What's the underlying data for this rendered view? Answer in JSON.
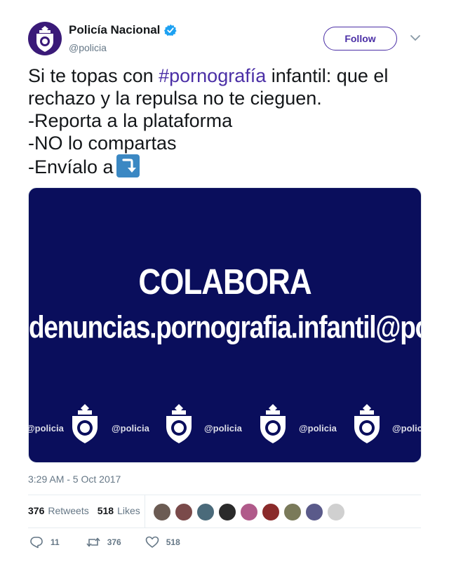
{
  "account": {
    "name": "Policía Nacional",
    "handle": "@policia",
    "verified": true,
    "follow_label": "Follow",
    "colors": {
      "accent": "#4b2fa6",
      "verified": "#1da1f2"
    }
  },
  "tweet": {
    "line1_prefix": "Si te topas con ",
    "line1_hashtag": "#pornografía",
    "line1_suffix": " infantil: que el",
    "line2": "rechazo y la repulsa no te cieguen.",
    "line3": "-Reporta a la plataforma",
    "line4": "-NO lo compartas",
    "line5": "-Envíalo a",
    "emoji": "arrow-curving-down-emoji"
  },
  "media": {
    "title": "COLABORA",
    "email": "denuncias.pornografia.infantil@policia.es",
    "watermark": "@policia",
    "background": "#0a0e5c"
  },
  "meta": {
    "timestamp": "3:29 AM - 5 Oct 2017",
    "retweets_count": "376",
    "retweets_label": "Retweets",
    "likes_count": "518",
    "likes_label": "Likes"
  },
  "actions": {
    "replies": "11",
    "retweets": "376",
    "likes": "518"
  }
}
